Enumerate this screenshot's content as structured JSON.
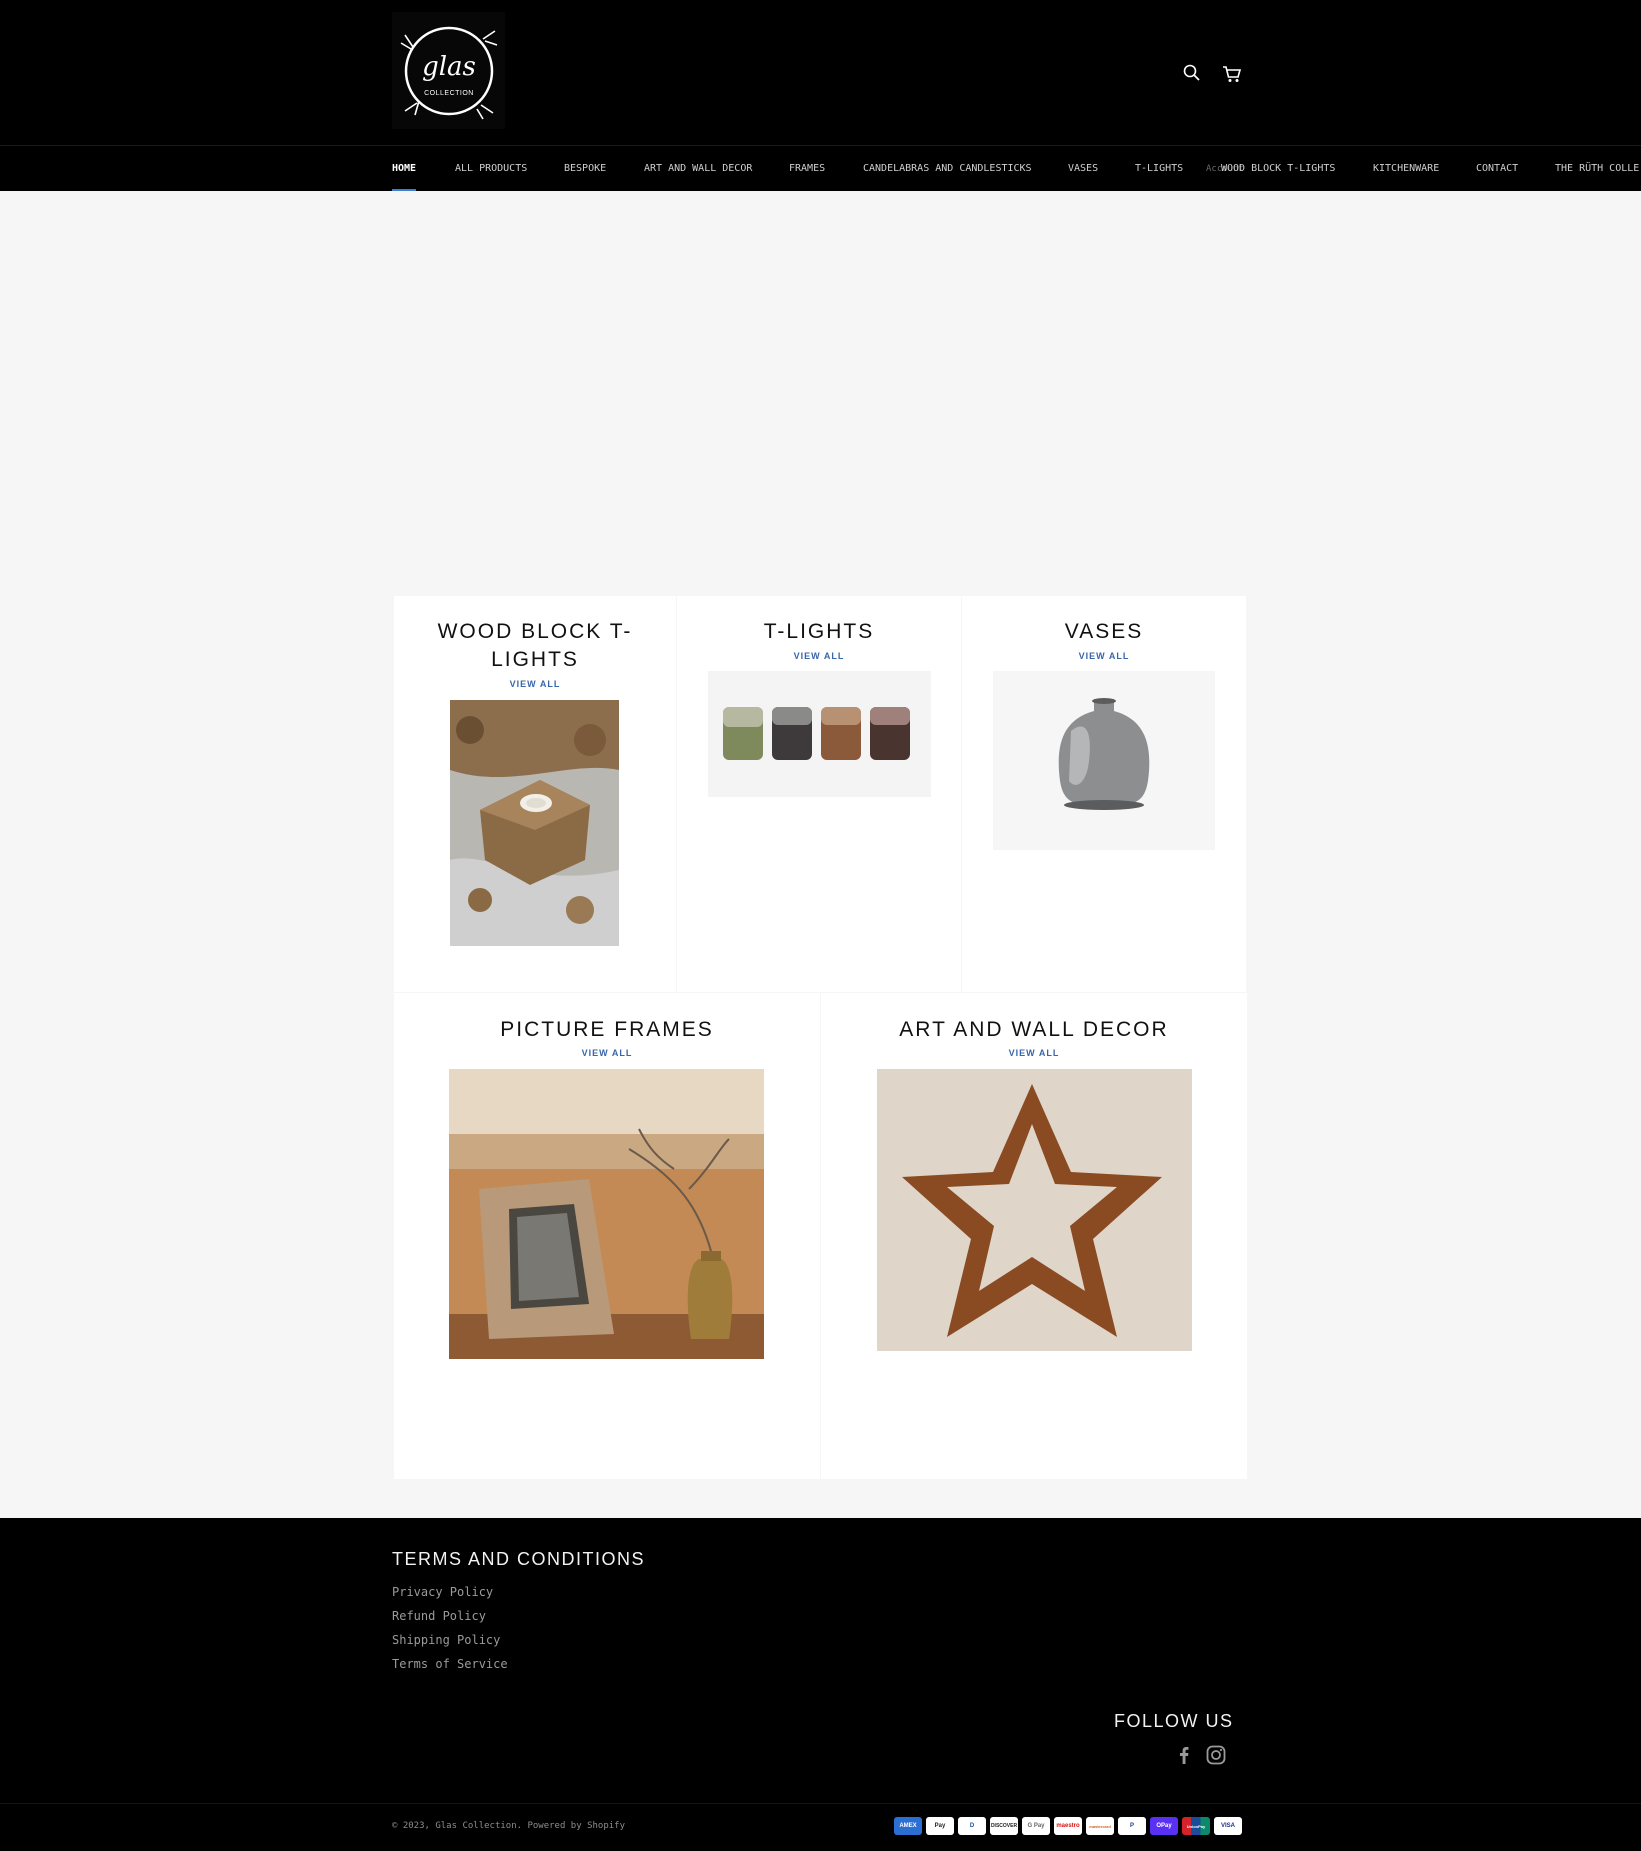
{
  "header": {
    "logo": {
      "text": "glas",
      "subtext": "COLLECTION"
    },
    "icons": {
      "search": "search-icon",
      "cart": "cart-icon"
    }
  },
  "nav": {
    "items": [
      {
        "label": "HOME",
        "active": true
      },
      {
        "label": "ALL PRODUCTS"
      },
      {
        "label": "BESPOKE"
      },
      {
        "label": "ART AND WALL DECOR"
      },
      {
        "label": "FRAMES"
      },
      {
        "label": "CANDELABRAS AND CANDLESTICKS"
      },
      {
        "label": "VASES"
      },
      {
        "label": "T-LIGHTS"
      },
      {
        "label": "WOOD BLOCK T-LIGHTS"
      },
      {
        "label": "KITCHENWARE"
      },
      {
        "label": "CONTACT"
      },
      {
        "label": "THE RÜTH COLLE"
      }
    ],
    "overlap_text": "Account"
  },
  "collections": [
    {
      "title": "WOOD BLOCK T-LIGHTS",
      "title_line1": "WOOD BLOCK T-",
      "title_line2": "LIGHTS",
      "link": "VIEW ALL"
    },
    {
      "title": "T-LIGHTS",
      "link": "VIEW ALL"
    },
    {
      "title": "VASES",
      "link": "VIEW ALL"
    },
    {
      "title": "PICTURE FRAMES",
      "link": "VIEW ALL"
    },
    {
      "title": "ART AND WALL DECOR",
      "link": "VIEW ALL"
    }
  ],
  "footer": {
    "terms_heading": "TERMS AND CONDITIONS",
    "links": [
      "Privacy Policy",
      "Refund Policy",
      "Shipping Policy",
      "Terms of Service"
    ],
    "follow_heading": "FOLLOW US",
    "social": [
      "facebook-icon",
      "instagram-icon"
    ],
    "copyright": "© 2023, Glas Collection. Powered by Shopify",
    "payments": [
      "AMEX",
      "Pay",
      "D",
      "DISCOVER",
      "G Pay",
      "maestro",
      "mastercard",
      "P",
      "OPay",
      "UnionPay",
      "VISA"
    ]
  },
  "colors": {
    "accent": "#3c7dd8",
    "link": "#3866a8",
    "header_bg": "#000000",
    "page_bg": "#f6f6f6"
  }
}
